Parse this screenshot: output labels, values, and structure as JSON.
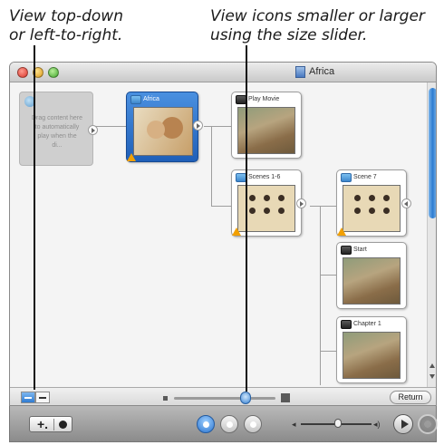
{
  "callouts": {
    "left": "View top-down\nor left-to-right.",
    "right": "View icons smaller or larger\nusing the size slider."
  },
  "window": {
    "title": "Africa",
    "title_icon": "folder-icon"
  },
  "placeholder": {
    "text": "Drag content here\nto automatically\nplay when the\ndi..."
  },
  "nodes": [
    {
      "label": "Africa",
      "icon": "menu-icon",
      "warning": true,
      "selected": true
    },
    {
      "label": "Play Movie",
      "icon": "movie-icon",
      "warning": false
    },
    {
      "label": "Scenes 1-6",
      "icon": "menu-icon",
      "warning": true
    },
    {
      "label": "Scene 7",
      "icon": "menu-icon",
      "warning": true
    },
    {
      "label": "Start",
      "icon": "movie-icon",
      "warning": false
    },
    {
      "label": "Chapter 1",
      "icon": "movie-icon",
      "warning": false
    }
  ],
  "view_bar": {
    "return_label": "Return",
    "size_slider_value": 0.73
  },
  "bottom_bar": {
    "add_label": "+.",
    "volume_value": 0.5
  },
  "colors": {
    "accent": "#2a74cf",
    "warning": "#f2a000"
  }
}
